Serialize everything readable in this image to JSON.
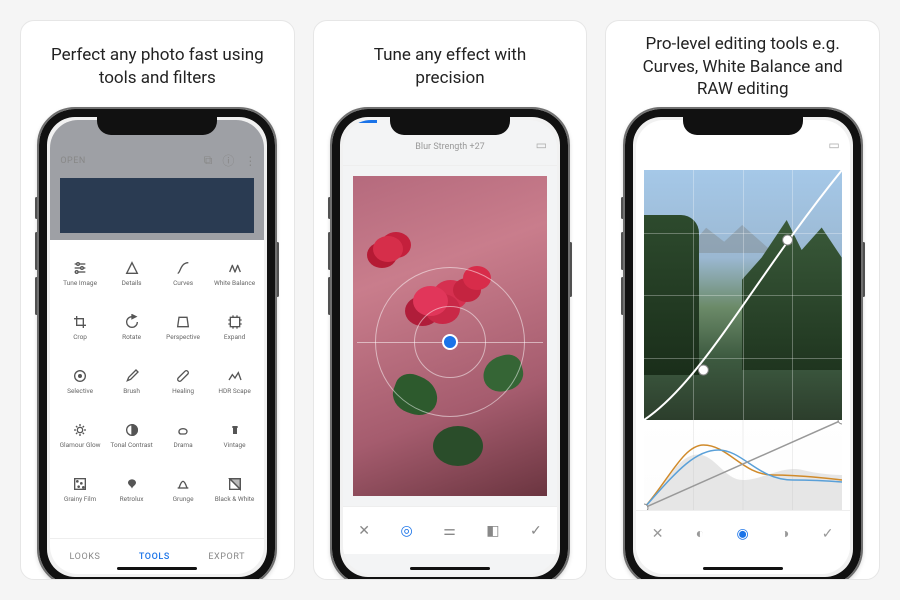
{
  "cards": [
    {
      "caption": "Perfect any photo fast using tools and filters"
    },
    {
      "caption": "Tune any effect with precision"
    },
    {
      "caption": "Pro-level editing tools e.g. Curves, White Balance and RAW editing"
    }
  ],
  "screen1": {
    "open": "OPEN",
    "header_icons": [
      "layers",
      "info",
      "more"
    ],
    "tools": [
      {
        "label": "Tune Image",
        "icon": "sliders"
      },
      {
        "label": "Details",
        "icon": "triangle"
      },
      {
        "label": "Curves",
        "icon": "curve"
      },
      {
        "label": "White Balance",
        "icon": "wb"
      },
      {
        "label": "Crop",
        "icon": "crop"
      },
      {
        "label": "Rotate",
        "icon": "rotate"
      },
      {
        "label": "Perspective",
        "icon": "perspective"
      },
      {
        "label": "Expand",
        "icon": "expand"
      },
      {
        "label": "Selective",
        "icon": "target"
      },
      {
        "label": "Brush",
        "icon": "brush"
      },
      {
        "label": "Healing",
        "icon": "bandage"
      },
      {
        "label": "HDR Scape",
        "icon": "hdr"
      },
      {
        "label": "Glamour Glow",
        "icon": "glow"
      },
      {
        "label": "Tonal Contrast",
        "icon": "tonal"
      },
      {
        "label": "Drama",
        "icon": "drama"
      },
      {
        "label": "Vintage",
        "icon": "vintage"
      },
      {
        "label": "Grainy Film",
        "icon": "film"
      },
      {
        "label": "Retrolux",
        "icon": "retro"
      },
      {
        "label": "Grunge",
        "icon": "grunge"
      },
      {
        "label": "Black & White",
        "icon": "bw"
      }
    ],
    "tabs": {
      "looks": "LOOKS",
      "tools": "TOOLS",
      "export": "EXPORT"
    }
  },
  "screen2": {
    "slider_label": "Blur Strength +27",
    "toolbar": [
      "close",
      "target",
      "tune",
      "mask",
      "check"
    ]
  },
  "screen3": {
    "toolbar": [
      "close",
      "luminance",
      "channel",
      "contrast",
      "check"
    ]
  }
}
